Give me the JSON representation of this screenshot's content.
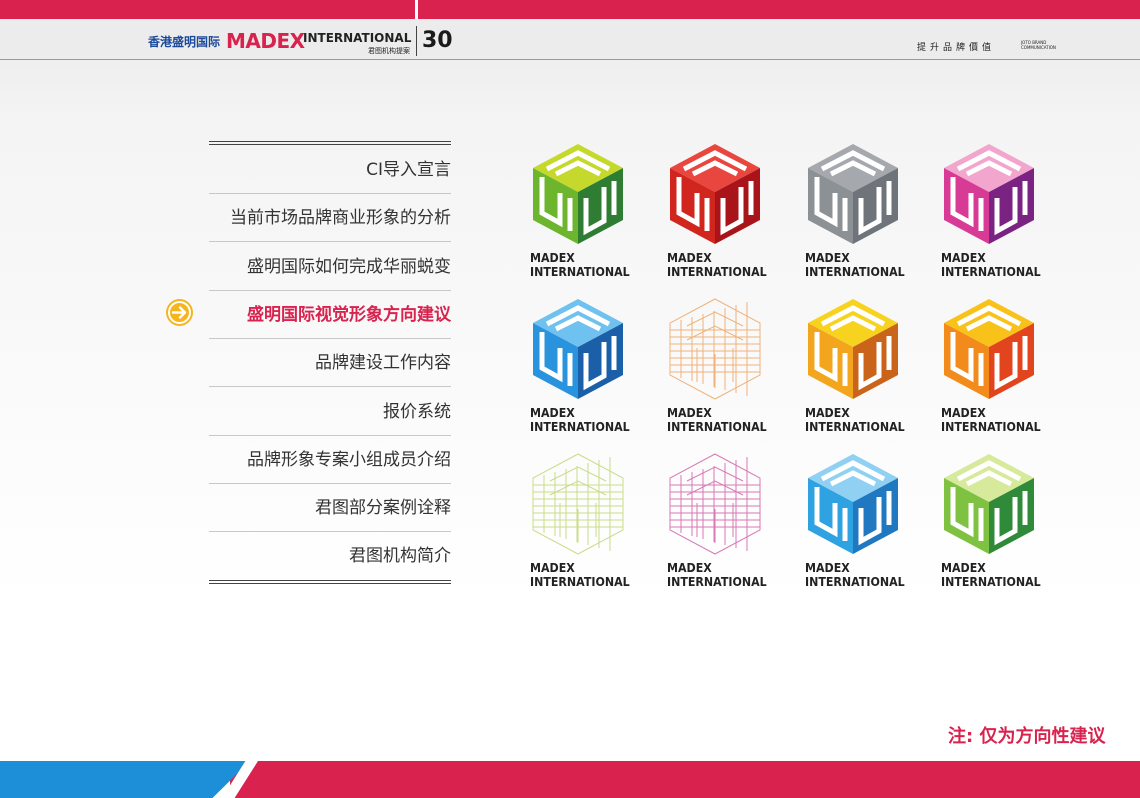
{
  "header": {
    "brand_cn": "香港盛明国际",
    "brand_madex": "MADEX",
    "brand_intl": "INTERNATIONAL",
    "brand_sub": "君图机构提案",
    "page_number": "30",
    "tagline": "提升品牌價值",
    "tagline_en": "JOTO BRAND COMMUNICATION"
  },
  "menu": [
    {
      "label": "CI导入宣言",
      "active": false
    },
    {
      "label": "当前市场品牌商业形象的分析",
      "active": false
    },
    {
      "label": "盛明国际如何完成华丽蜕变",
      "active": false
    },
    {
      "label": "盛明国际视觉形象方向建议",
      "active": true
    },
    {
      "label": "品牌建设工作内容",
      "active": false
    },
    {
      "label": "报价系统",
      "active": false
    },
    {
      "label": "品牌形象专案小组成员介绍",
      "active": false
    },
    {
      "label": "君图部分案例诠释",
      "active": false
    },
    {
      "label": "君图机构简介",
      "active": false
    }
  ],
  "logo_line1": "MADEX",
  "logo_line2": "INTERNATIONAL",
  "logos": [
    {
      "style": "green",
      "colors": [
        "#c4d92c",
        "#6cb52d",
        "#2e7d32"
      ]
    },
    {
      "style": "red",
      "colors": [
        "#e8463e",
        "#d1261e",
        "#a8141a"
      ]
    },
    {
      "style": "gray",
      "colors": [
        "#a5a9ad",
        "#8c9196",
        "#6f747a"
      ]
    },
    {
      "style": "pink",
      "colors": [
        "#f3a6cd",
        "#d83b96",
        "#7a2383"
      ]
    },
    {
      "style": "blue",
      "colors": [
        "#6fc1ef",
        "#2a93dd",
        "#1a5fa8"
      ]
    },
    {
      "style": "orange-line",
      "colors": [
        "#f0b27a",
        "#f0b27a",
        "#f0b27a"
      ]
    },
    {
      "style": "yellow",
      "colors": [
        "#f7d21f",
        "#f2a51d",
        "#c9641a"
      ]
    },
    {
      "style": "orange",
      "colors": [
        "#f9c21b",
        "#f28b1c",
        "#e2451d"
      ]
    },
    {
      "style": "lime-line",
      "colors": [
        "#c9dc88",
        "#c9dc88",
        "#c9dc88"
      ]
    },
    {
      "style": "magenta-line",
      "colors": [
        "#d879b5",
        "#d879b5",
        "#d879b5"
      ]
    },
    {
      "style": "sky",
      "colors": [
        "#8fd0f3",
        "#2fa2e2",
        "#1f78c0"
      ]
    },
    {
      "style": "lime",
      "colors": [
        "#d7ea9c",
        "#7fc242",
        "#2f8a3a"
      ]
    }
  ],
  "note": "注: 仅为方向性建议"
}
